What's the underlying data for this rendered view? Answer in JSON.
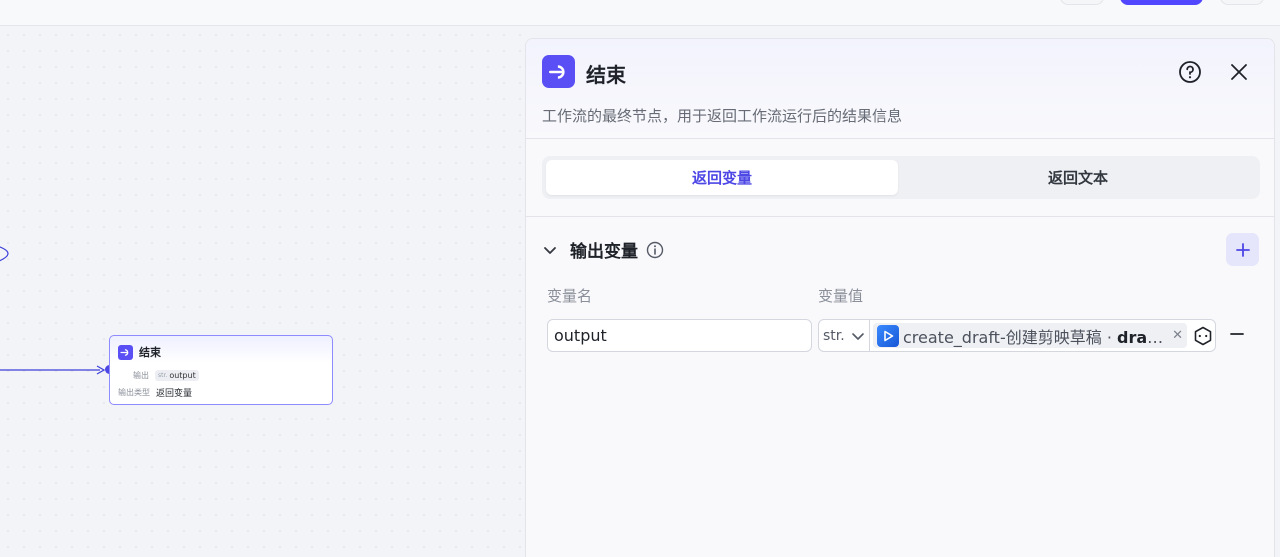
{
  "canvas": {
    "node": {
      "title": "结束",
      "output_label": "输出",
      "output_type_prefix": "str.",
      "output_value": "output",
      "output_type_label": "输出类型",
      "output_type_value": "返回变量"
    }
  },
  "panel": {
    "title": "结束",
    "description": "工作流的最终节点，用于返回工作流运行后的结果信息",
    "tabs": [
      {
        "label": "返回变量",
        "active": true
      },
      {
        "label": "返回文本",
        "active": false
      }
    ],
    "section": {
      "title": "输出变量",
      "columns": {
        "name": "变量名",
        "value": "变量值"
      },
      "rows": [
        {
          "name": "output",
          "type": "str.",
          "ref_source": "create_draft-创建剪映草稿 · ",
          "ref_field": "draf···"
        }
      ]
    }
  },
  "colors": {
    "accent": "#4d47e5",
    "node_icon": "#5a4ff5",
    "edge": "#3b3fd9"
  }
}
